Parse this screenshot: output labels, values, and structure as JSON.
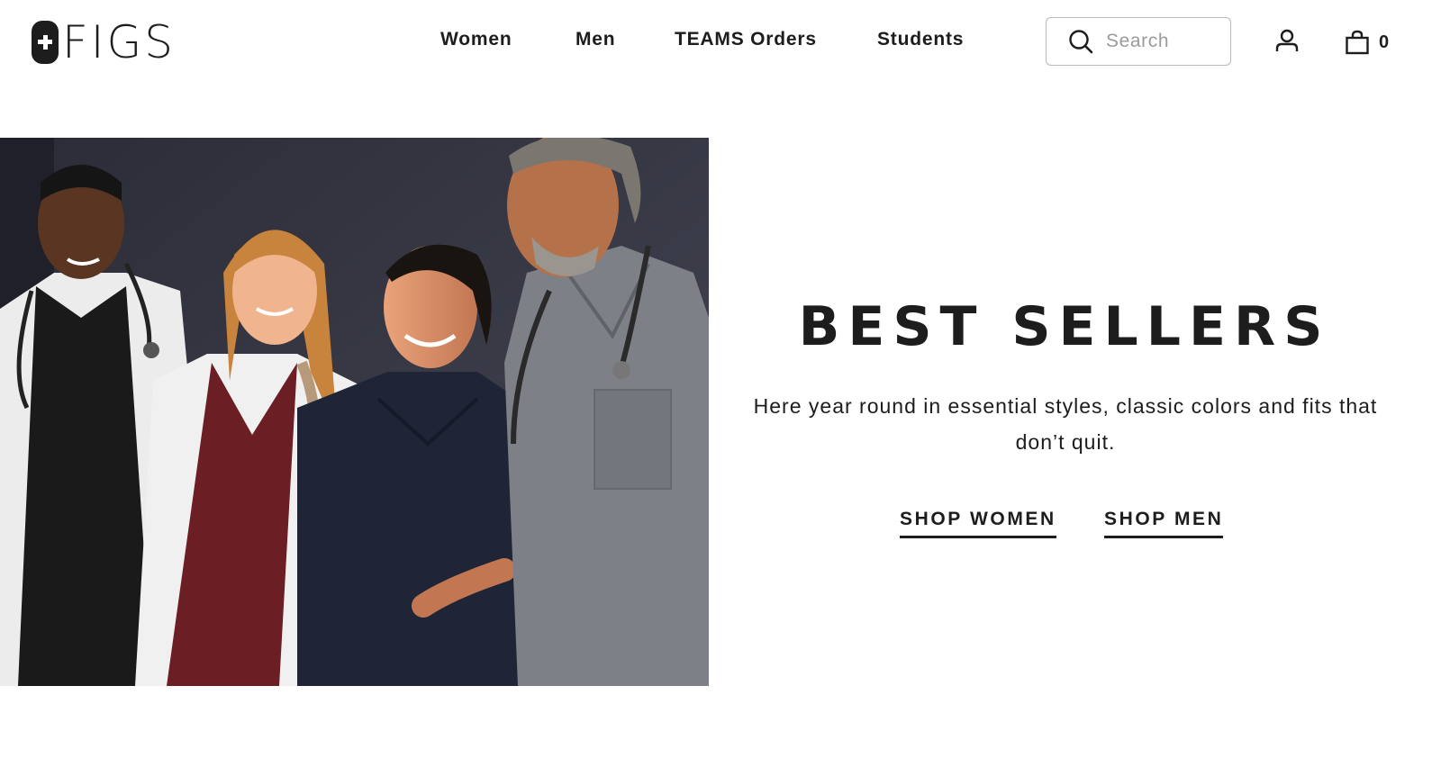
{
  "brand": {
    "name": "FIGS"
  },
  "nav": {
    "items": [
      {
        "label": "Women"
      },
      {
        "label": "Men"
      },
      {
        "label": "TEAMS Orders"
      },
      {
        "label": "Students"
      }
    ]
  },
  "search": {
    "placeholder": "Search",
    "value": ""
  },
  "cart": {
    "count": "0"
  },
  "hero": {
    "title": "BEST SELLERS",
    "subtitle": "Here year round in essential styles, classic colors and fits that don’t quit.",
    "cta_women": "SHOP WOMEN",
    "cta_men": "SHOP MEN"
  },
  "icons": {
    "search": "search-icon",
    "account": "account-icon",
    "cart": "shopping-bag-icon"
  },
  "colors": {
    "text": "#1d1d1d",
    "background": "#ffffff",
    "search_border": "#b9b9b9",
    "placeholder": "#9b9b9b"
  }
}
